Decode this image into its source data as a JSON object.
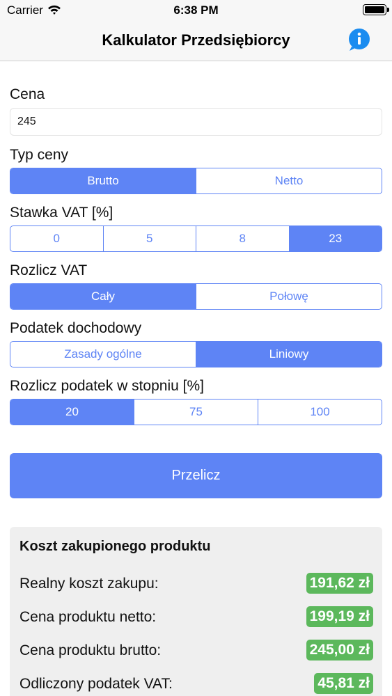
{
  "status_bar": {
    "carrier": "Carrier",
    "time": "6:38 PM"
  },
  "nav": {
    "title": "Kalkulator Przedsiębiorcy"
  },
  "form": {
    "price_label": "Cena",
    "price_value": "245",
    "price_type": {
      "label": "Typ ceny",
      "options": [
        "Brutto",
        "Netto"
      ],
      "selected": "Brutto"
    },
    "vat_rate": {
      "label": "Stawka VAT [%]",
      "options": [
        "0",
        "5",
        "8",
        "23"
      ],
      "selected": "23"
    },
    "vat_settlement": {
      "label": "Rozlicz VAT",
      "options": [
        "Cały",
        "Połowę"
      ],
      "selected": "Cały"
    },
    "income_tax": {
      "label": "Podatek dochodowy",
      "options": [
        "Zasady ogólne",
        "Liniowy"
      ],
      "selected": "Liniowy"
    },
    "tax_degree": {
      "label": "Rozlicz podatek w stopniu [%]",
      "options": [
        "20",
        "75",
        "100"
      ],
      "selected": "20"
    },
    "calculate_label": "Przelicz"
  },
  "results": {
    "title": "Koszt zakupionego produktu",
    "rows": [
      {
        "label": "Realny koszt zakupu:",
        "value": "191,62 zł"
      },
      {
        "label": "Cena produktu netto:",
        "value": "199,19 zł"
      },
      {
        "label": "Cena produktu brutto:",
        "value": "245,00 zł"
      },
      {
        "label": "Odliczony podatek VAT:",
        "value": "45,81 zł"
      }
    ]
  },
  "colors": {
    "accent": "#5e84f5",
    "success": "#5cb85c"
  },
  "icons": {
    "info": "info-icon",
    "wifi": "wifi-icon",
    "battery": "battery-icon"
  }
}
